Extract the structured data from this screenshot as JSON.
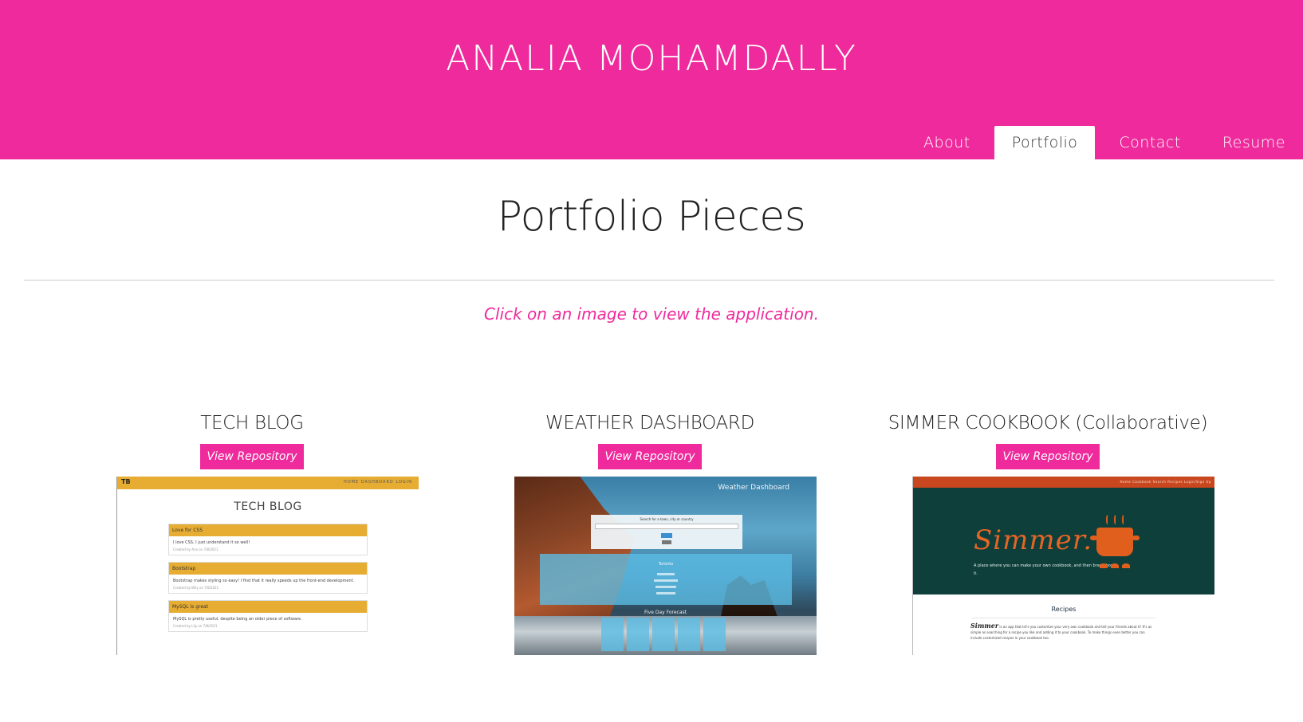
{
  "header": {
    "title": "ANALIA MOHAMDALLY",
    "background_color": "#ee2a9c",
    "nav": [
      {
        "label": "About",
        "active": false
      },
      {
        "label": "Portfolio",
        "active": true
      },
      {
        "label": "Contact",
        "active": false
      },
      {
        "label": "Resume",
        "active": false
      }
    ]
  },
  "main": {
    "title": "Portfolio Pieces",
    "instruction": "Click on an image to view the application.",
    "accent_color": "#ee2a9c",
    "projects": [
      {
        "title": "TECH BLOG",
        "button_label": "View Repository",
        "thumbnail": {
          "logo": "TB",
          "nav_links": "HOME   DASHBOARD   LOGIN",
          "heading": "TECH BLOG",
          "posts": [
            {
              "title": "Love for CSS",
              "body": "I love CSS, I just understand it so well!",
              "meta": "Created by Ana on 7/8/2021"
            },
            {
              "title": "Bootstrap",
              "body": "Bootstrap makes styling so easy! I find that it really speeds up the front-end development.",
              "meta": "Created by Billy on 7/8/2021"
            },
            {
              "title": "MySQL is great",
              "body": "MySQL is pretty useful, despite being an older piece of software.",
              "meta": "Created by Lily on 7/8/2021"
            }
          ]
        }
      },
      {
        "title": "WEATHER DASHBOARD",
        "button_label": "View Repository",
        "thumbnail": {
          "heading": "Weather Dashboard",
          "search_label": "Search for a town, city or country",
          "city": "Toronto",
          "forecast_label": "Five Day Forecast"
        }
      },
      {
        "title": "SIMMER COOKBOOK (Collaborative)",
        "button_label": "View Repository",
        "thumbnail": {
          "nav_links": "Home    Cookbook    Search Recipes    Login/Sign Up",
          "logo": "Simmer.",
          "tagline": "A place where you can make your own cookbook, and then brag about it.",
          "section_title": "Recipes",
          "about_brand": "Simmer",
          "about_text": "is an app that let's you customize your very own cookbook and tell your friends about it! It's as simple as searching for a recipe you like and adding it to your cookbook. To make things even better you can include customized recipes in your cookbook too."
        }
      }
    ]
  }
}
